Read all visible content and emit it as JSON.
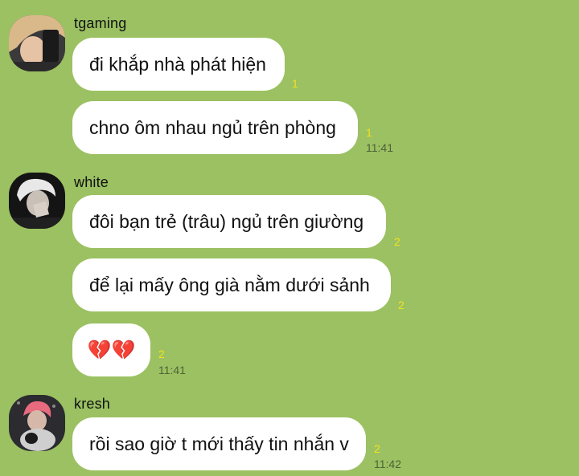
{
  "colors": {
    "background": "#9bc162",
    "bubble": "#ffffff",
    "read_count": "#f2e21f",
    "timestamp": "#4f6237"
  },
  "messages": [
    {
      "sender": "tgaming",
      "lines": [
        {
          "text": "đi khắp nhà phát hiện",
          "read": "1"
        },
        {
          "text": "chno ôm nhau ngủ trên phòng",
          "read": "1",
          "time": "11:41"
        }
      ]
    },
    {
      "sender": "white",
      "lines": [
        {
          "text": "đôi bạn trẻ (trâu) ngủ trên giường",
          "read": "2"
        },
        {
          "text": "để lại mấy ông già nằm dưới sảnh",
          "read": "2"
        },
        {
          "text": "💔💔",
          "read": "2",
          "time": "11:41"
        }
      ]
    },
    {
      "sender": "kresh",
      "lines": [
        {
          "text": "rồi sao giờ t mới thấy tin nhắn v",
          "read": "2",
          "time": "11:42"
        }
      ]
    }
  ]
}
